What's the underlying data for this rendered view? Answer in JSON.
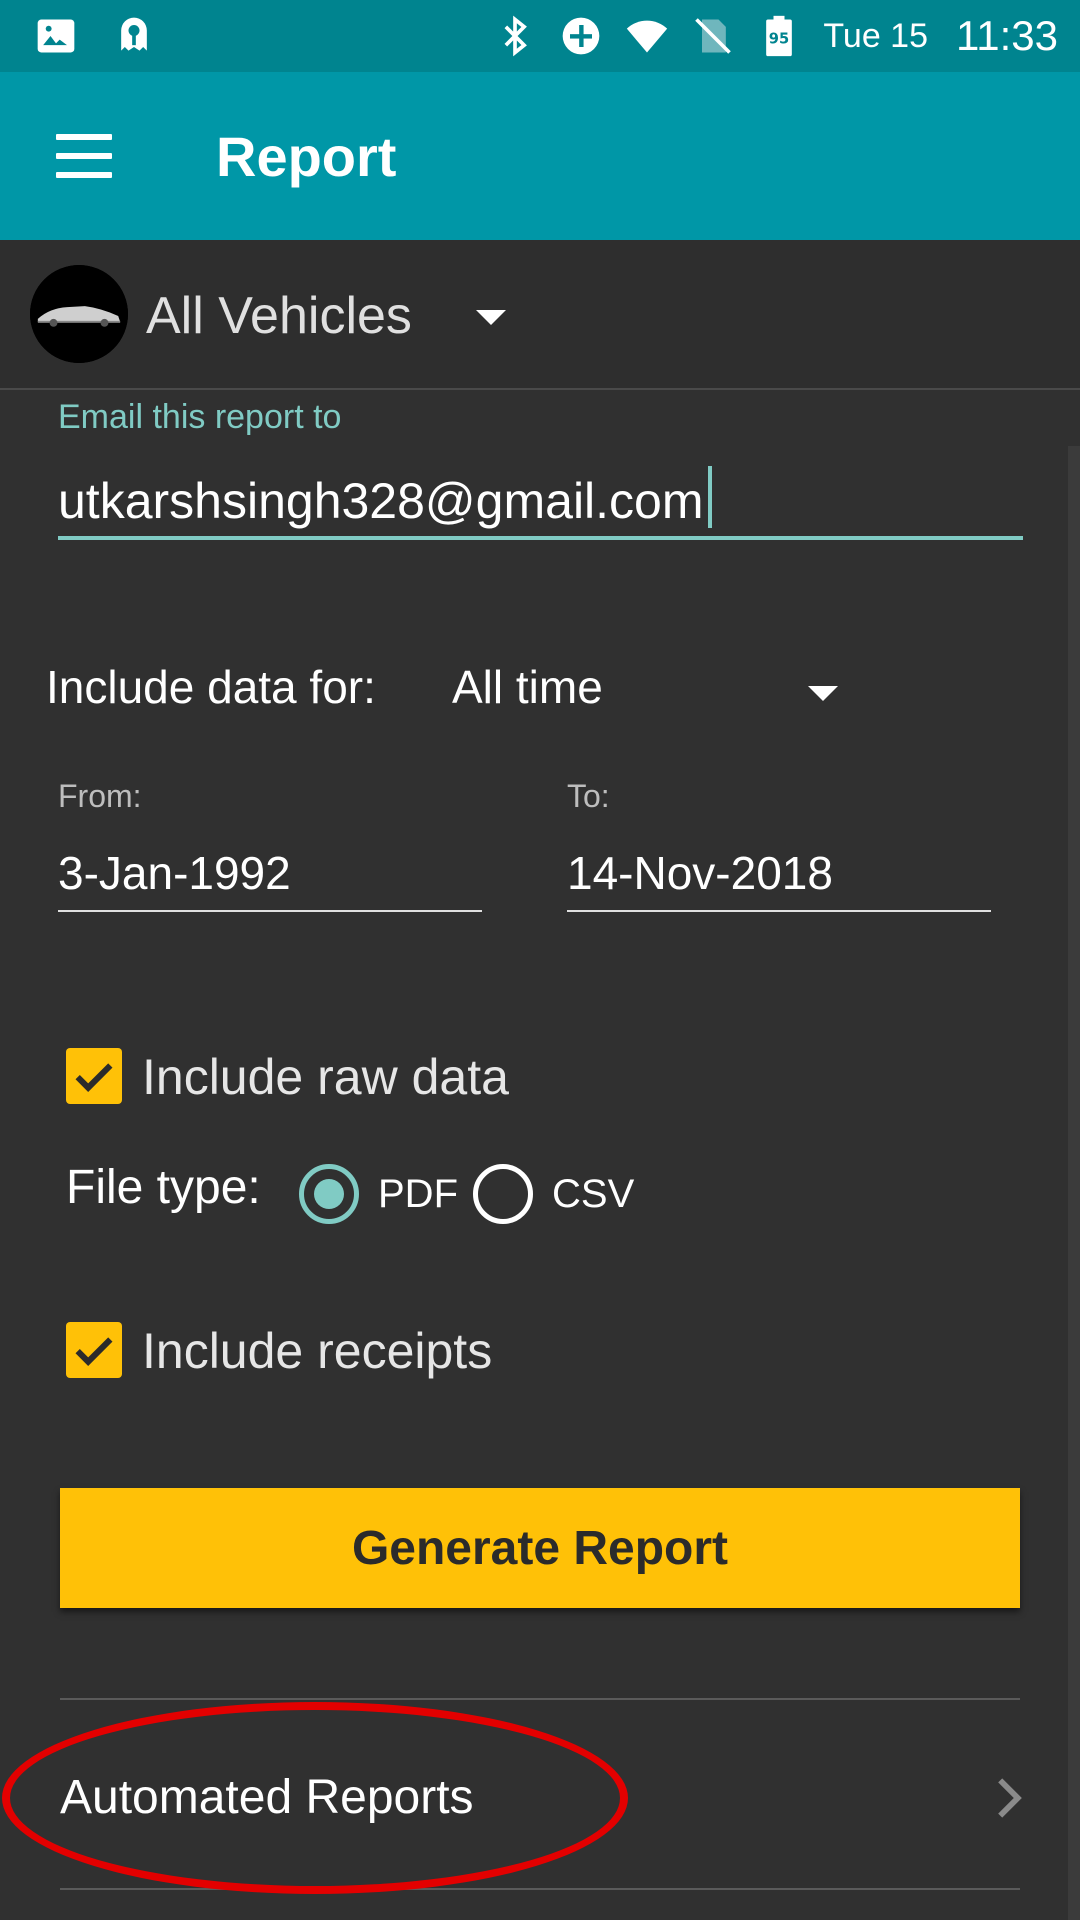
{
  "status_bar": {
    "date": "Tue 15",
    "time": "11:33",
    "battery_level": "95",
    "icons": [
      "image-icon",
      "app-notification-icon",
      "bluetooth-icon",
      "data-saver-icon",
      "wifi-icon",
      "no-sim-icon",
      "battery-icon"
    ]
  },
  "app_bar": {
    "title": "Report",
    "colors": {
      "app_bar": "#0097a7",
      "status_bar": "#00848f"
    }
  },
  "vehicle_selector": {
    "selected": "All Vehicles"
  },
  "form": {
    "email_label": "Email this report to",
    "email_value": "utkarshsingh328@gmail.com",
    "include_label": "Include data for:",
    "range_value": "All time",
    "from_label": "From:",
    "from_value": "3-Jan-1992",
    "to_label": "To:",
    "to_value": "14-Nov-2018",
    "include_raw_label": "Include raw data",
    "include_raw_checked": true,
    "file_type_label": "File type:",
    "file_type_options": [
      {
        "label": "PDF",
        "selected": true
      },
      {
        "label": "CSV",
        "selected": false
      }
    ],
    "include_receipts_label": "Include receipts",
    "include_receipts_checked": true,
    "generate_label": "Generate Report",
    "accent_color": "#80cbc4",
    "button_color": "#ffc107"
  },
  "automated_reports": {
    "label": "Automated Reports"
  }
}
